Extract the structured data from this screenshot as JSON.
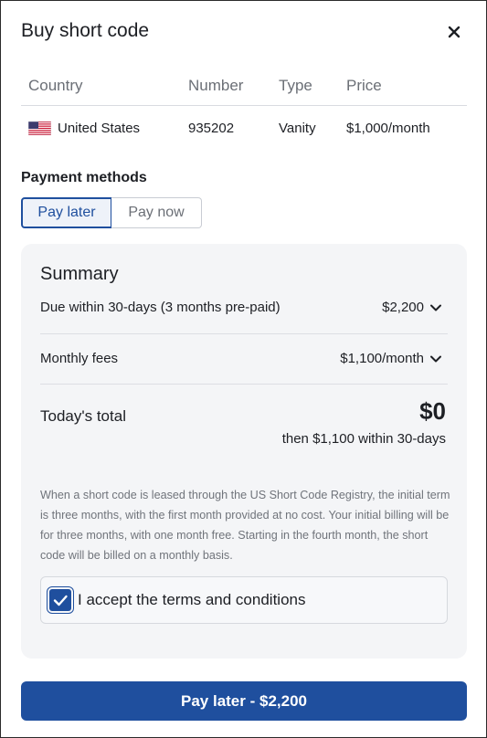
{
  "dialog": {
    "title": "Buy short code"
  },
  "table": {
    "headers": [
      "Country",
      "Number",
      "Type",
      "Price"
    ],
    "row": {
      "country": "United States",
      "number": "935202",
      "type": "Vanity",
      "price": "$1,000/month"
    }
  },
  "payment": {
    "section_title": "Payment methods",
    "options": [
      "Pay later",
      "Pay now"
    ],
    "selected": "Pay later"
  },
  "summary": {
    "title": "Summary",
    "due_label": "Due within 30-days (3 months pre-paid)",
    "due_value": "$2,200",
    "monthly_label": "Monthly fees",
    "monthly_value": "$1,100/month",
    "total_label": "Today's total",
    "total_value": "$0",
    "total_sub": "then $1,100 within 30-days",
    "note": "When a short code is leased through the US Short Code Registry, the initial term is three months, with the first month provided at no cost. Your initial billing will be for three months, with one month free. Starting in the fourth month, the short code will be billed on a monthly basis.",
    "terms_label": "I accept the terms and conditions",
    "terms_checked": true
  },
  "action": {
    "button_label": "Pay later - $2,200"
  },
  "colors": {
    "accent": "#1f4f9e",
    "card_bg": "#f4f5f7",
    "muted_text": "#6b6f76"
  },
  "icons": [
    "close-icon",
    "us-flag-icon",
    "chevron-down-icon",
    "checkmark-icon"
  ]
}
